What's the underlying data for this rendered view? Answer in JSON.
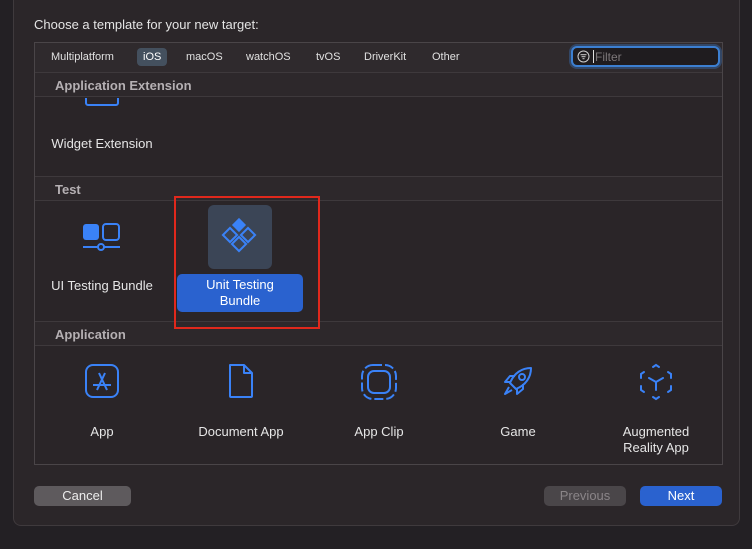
{
  "dialog": {
    "prompt": "Choose a template for your new target:"
  },
  "platforms": {
    "tabs": [
      "Multiplatform",
      "iOS",
      "macOS",
      "watchOS",
      "tvOS",
      "DriverKit",
      "Other"
    ],
    "selected": "iOS"
  },
  "filter": {
    "placeholder": "Filter",
    "value": ""
  },
  "sections": {
    "app_extension": {
      "title": "Application Extension",
      "items": [
        "Widget Extension"
      ]
    },
    "test": {
      "title": "Test",
      "items": [
        "UI Testing Bundle",
        "Unit Testing Bundle"
      ],
      "selected": "Unit Testing Bundle"
    },
    "application": {
      "title": "Application",
      "items": [
        "App",
        "Document App",
        "App Clip",
        "Game",
        "Augmented Reality App"
      ]
    }
  },
  "unit_testing_label": {
    "line1": "Unit Testing",
    "line2": "Bundle"
  },
  "ar_label": {
    "line1": "Augmented",
    "line2": "Reality App"
  },
  "buttons": {
    "cancel": "Cancel",
    "previous": "Previous",
    "next": "Next"
  },
  "colors": {
    "accent": "#2a62cf",
    "icon_blue": "#3a82f7",
    "highlight": "#e0281c"
  }
}
